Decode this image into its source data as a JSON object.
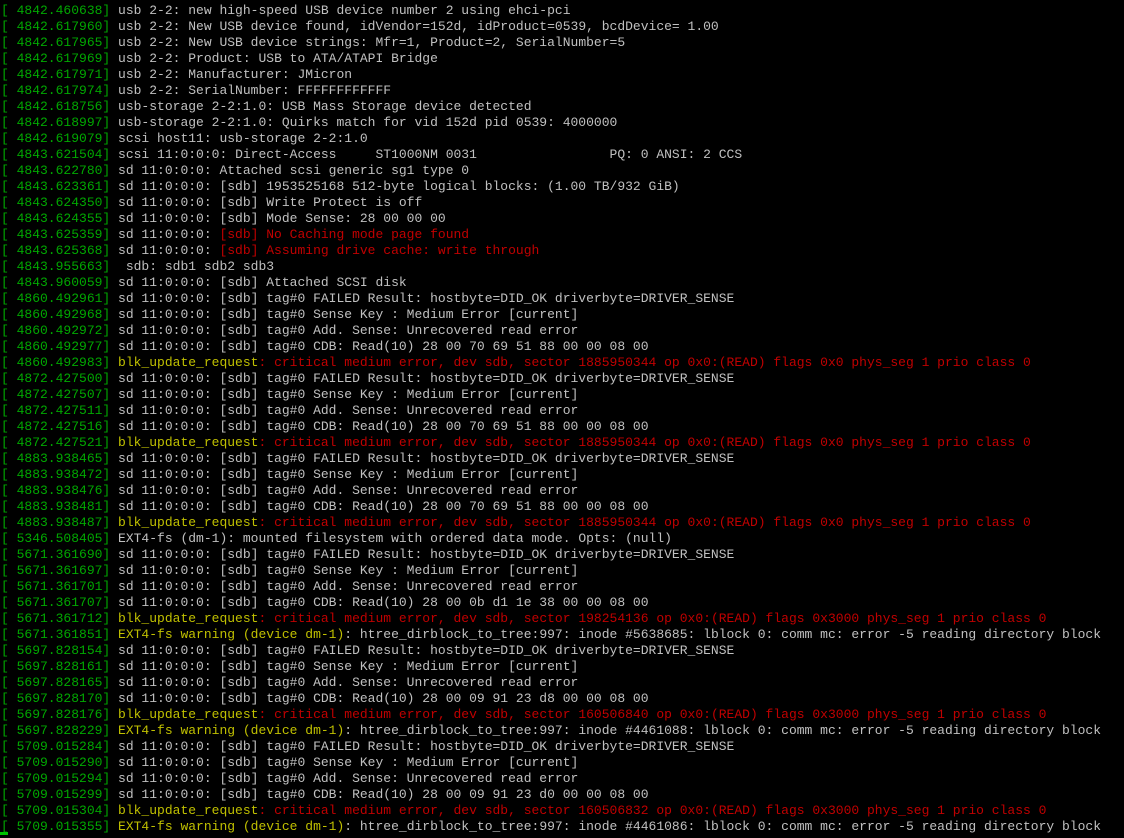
{
  "terminal": {
    "lines": [
      {
        "ts": "[ 4842.460638] ",
        "src": "usb 2-2: ",
        "msg": "new high-speed USB device number 2 using ehci-pci",
        "kind": "normal"
      },
      {
        "ts": "[ 4842.617960] ",
        "src": "usb 2-2: ",
        "msg": "New USB device found, idVendor=152d, idProduct=0539, bcdDevice= 1.00",
        "kind": "normal"
      },
      {
        "ts": "[ 4842.617965] ",
        "src": "usb 2-2: ",
        "msg": "New USB device strings: Mfr=1, Product=2, SerialNumber=5",
        "kind": "normal"
      },
      {
        "ts": "[ 4842.617969] ",
        "src": "usb 2-2: ",
        "msg": "Product: USB to ATA/ATAPI Bridge",
        "kind": "normal"
      },
      {
        "ts": "[ 4842.617971] ",
        "src": "usb 2-2: ",
        "msg": "Manufacturer: JMicron",
        "kind": "normal"
      },
      {
        "ts": "[ 4842.617974] ",
        "src": "usb 2-2: ",
        "msg": "SerialNumber: FFFFFFFFFFFF",
        "kind": "normal"
      },
      {
        "ts": "[ 4842.618756] ",
        "src": "usb-storage 2-2:1.0: ",
        "msg": "USB Mass Storage device detected",
        "kind": "normal"
      },
      {
        "ts": "[ 4842.618997] ",
        "src": "usb-storage 2-2:1.0: ",
        "msg": "Quirks match for vid 152d pid 0539: 4000000",
        "kind": "normal"
      },
      {
        "ts": "[ 4842.619079] ",
        "src": "scsi host11: ",
        "msg": "usb-storage 2-2:1.0",
        "kind": "normal"
      },
      {
        "ts": "[ 4843.621504] ",
        "src": "scsi 11:0:0:0: ",
        "msg": "Direct-Access     ST1000NM 0031                 PQ: 0 ANSI: 2 CCS",
        "kind": "normal"
      },
      {
        "ts": "[ 4843.622780] ",
        "src": "sd 11:0:0:0: ",
        "msg": "Attached scsi generic sg1 type 0",
        "kind": "normal"
      },
      {
        "ts": "[ 4843.623361] ",
        "src": "sd 11:0:0:0: ",
        "msg": "[sdb] 1953525168 512-byte logical blocks: (1.00 TB/932 GiB)",
        "kind": "normal"
      },
      {
        "ts": "[ 4843.624350] ",
        "src": "sd 11:0:0:0: ",
        "msg": "[sdb] Write Protect is off",
        "kind": "normal"
      },
      {
        "ts": "[ 4843.624355] ",
        "src": "sd 11:0:0:0: ",
        "msg": "[sdb] Mode Sense: 28 00 00 00",
        "kind": "normal"
      },
      {
        "ts": "[ 4843.625359] ",
        "src": "sd 11:0:0:0: ",
        "msg": "[sdb] No Caching mode page found",
        "kind": "red"
      },
      {
        "ts": "[ 4843.625368] ",
        "src": "sd 11:0:0:0: ",
        "msg": "[sdb] Assuming drive cache: write through",
        "kind": "red"
      },
      {
        "ts": "[ 4843.955663] ",
        "src": " sdb: ",
        "msg": "sdb1 sdb2 sdb3",
        "kind": "normal"
      },
      {
        "ts": "[ 4843.960059] ",
        "src": "sd 11:0:0:0: ",
        "msg": "[sdb] Attached SCSI disk",
        "kind": "normal"
      },
      {
        "ts": "[ 4860.492961] ",
        "src": "sd 11:0:0:0: ",
        "msg": "[sdb] tag#0 FAILED Result: hostbyte=DID_OK driverbyte=DRIVER_SENSE",
        "kind": "normal"
      },
      {
        "ts": "[ 4860.492968] ",
        "src": "sd 11:0:0:0: ",
        "msg": "[sdb] tag#0 Sense Key : Medium Error [current]",
        "kind": "normal"
      },
      {
        "ts": "[ 4860.492972] ",
        "src": "sd 11:0:0:0: ",
        "msg": "[sdb] tag#0 Add. Sense: Unrecovered read error",
        "kind": "normal"
      },
      {
        "ts": "[ 4860.492977] ",
        "src": "sd 11:0:0:0: ",
        "msg": "[sdb] tag#0 CDB: Read(10) 28 00 70 69 51 88 00 00 08 00",
        "kind": "normal"
      },
      {
        "ts": "[ 4860.492983] ",
        "src": "blk_update_request",
        "msg": ": critical medium error, dev sdb, sector 1885950344 op 0x0:(READ) flags 0x0 phys_seg 1 prio class 0",
        "kind": "crit"
      },
      {
        "ts": "[ 4872.427500] ",
        "src": "sd 11:0:0:0: ",
        "msg": "[sdb] tag#0 FAILED Result: hostbyte=DID_OK driverbyte=DRIVER_SENSE",
        "kind": "normal"
      },
      {
        "ts": "[ 4872.427507] ",
        "src": "sd 11:0:0:0: ",
        "msg": "[sdb] tag#0 Sense Key : Medium Error [current]",
        "kind": "normal"
      },
      {
        "ts": "[ 4872.427511] ",
        "src": "sd 11:0:0:0: ",
        "msg": "[sdb] tag#0 Add. Sense: Unrecovered read error",
        "kind": "normal"
      },
      {
        "ts": "[ 4872.427516] ",
        "src": "sd 11:0:0:0: ",
        "msg": "[sdb] tag#0 CDB: Read(10) 28 00 70 69 51 88 00 00 08 00",
        "kind": "normal"
      },
      {
        "ts": "[ 4872.427521] ",
        "src": "blk_update_request",
        "msg": ": critical medium error, dev sdb, sector 1885950344 op 0x0:(READ) flags 0x0 phys_seg 1 prio class 0",
        "kind": "crit"
      },
      {
        "ts": "[ 4883.938465] ",
        "src": "sd 11:0:0:0: ",
        "msg": "[sdb] tag#0 FAILED Result: hostbyte=DID_OK driverbyte=DRIVER_SENSE",
        "kind": "normal"
      },
      {
        "ts": "[ 4883.938472] ",
        "src": "sd 11:0:0:0: ",
        "msg": "[sdb] tag#0 Sense Key : Medium Error [current]",
        "kind": "normal"
      },
      {
        "ts": "[ 4883.938476] ",
        "src": "sd 11:0:0:0: ",
        "msg": "[sdb] tag#0 Add. Sense: Unrecovered read error",
        "kind": "normal"
      },
      {
        "ts": "[ 4883.938481] ",
        "src": "sd 11:0:0:0: ",
        "msg": "[sdb] tag#0 CDB: Read(10) 28 00 70 69 51 88 00 00 08 00",
        "kind": "normal"
      },
      {
        "ts": "[ 4883.938487] ",
        "src": "blk_update_request",
        "msg": ": critical medium error, dev sdb, sector 1885950344 op 0x0:(READ) flags 0x0 phys_seg 1 prio class 0",
        "kind": "crit"
      },
      {
        "ts": "[ 5346.508405] ",
        "src": "EXT4-fs (dm-1): ",
        "msg": "mounted filesystem with ordered data mode. Opts: (null)",
        "kind": "normal"
      },
      {
        "ts": "[ 5671.361690] ",
        "src": "sd 11:0:0:0: ",
        "msg": "[sdb] tag#0 FAILED Result: hostbyte=DID_OK driverbyte=DRIVER_SENSE",
        "kind": "normal"
      },
      {
        "ts": "[ 5671.361697] ",
        "src": "sd 11:0:0:0: ",
        "msg": "[sdb] tag#0 Sense Key : Medium Error [current]",
        "kind": "normal"
      },
      {
        "ts": "[ 5671.361701] ",
        "src": "sd 11:0:0:0: ",
        "msg": "[sdb] tag#0 Add. Sense: Unrecovered read error",
        "kind": "normal"
      },
      {
        "ts": "[ 5671.361707] ",
        "src": "sd 11:0:0:0: ",
        "msg": "[sdb] tag#0 CDB: Read(10) 28 00 0b d1 1e 38 00 00 08 00",
        "kind": "normal"
      },
      {
        "ts": "[ 5671.361712] ",
        "src": "blk_update_request",
        "msg": ": critical medium error, dev sdb, sector 198254136 op 0x0:(READ) flags 0x3000 phys_seg 1 prio class 0",
        "kind": "crit"
      },
      {
        "ts": "[ 5671.361851] ",
        "src": "EXT4-fs warning (device dm-1)",
        "msg": ": htree_dirblock_to_tree:997: inode #5638685: lblock 0: comm mc: error -5 reading directory block",
        "kind": "warn"
      },
      {
        "ts": "[ 5697.828154] ",
        "src": "sd 11:0:0:0: ",
        "msg": "[sdb] tag#0 FAILED Result: hostbyte=DID_OK driverbyte=DRIVER_SENSE",
        "kind": "normal"
      },
      {
        "ts": "[ 5697.828161] ",
        "src": "sd 11:0:0:0: ",
        "msg": "[sdb] tag#0 Sense Key : Medium Error [current]",
        "kind": "normal"
      },
      {
        "ts": "[ 5697.828165] ",
        "src": "sd 11:0:0:0: ",
        "msg": "[sdb] tag#0 Add. Sense: Unrecovered read error",
        "kind": "normal"
      },
      {
        "ts": "[ 5697.828170] ",
        "src": "sd 11:0:0:0: ",
        "msg": "[sdb] tag#0 CDB: Read(10) 28 00 09 91 23 d8 00 00 08 00",
        "kind": "normal"
      },
      {
        "ts": "[ 5697.828176] ",
        "src": "blk_update_request",
        "msg": ": critical medium error, dev sdb, sector 160506840 op 0x0:(READ) flags 0x3000 phys_seg 1 prio class 0",
        "kind": "crit"
      },
      {
        "ts": "[ 5697.828229] ",
        "src": "EXT4-fs warning (device dm-1)",
        "msg": ": htree_dirblock_to_tree:997: inode #4461088: lblock 0: comm mc: error -5 reading directory block",
        "kind": "warn"
      },
      {
        "ts": "[ 5709.015284] ",
        "src": "sd 11:0:0:0: ",
        "msg": "[sdb] tag#0 FAILED Result: hostbyte=DID_OK driverbyte=DRIVER_SENSE",
        "kind": "normal"
      },
      {
        "ts": "[ 5709.015290] ",
        "src": "sd 11:0:0:0: ",
        "msg": "[sdb] tag#0 Sense Key : Medium Error [current]",
        "kind": "normal"
      },
      {
        "ts": "[ 5709.015294] ",
        "src": "sd 11:0:0:0: ",
        "msg": "[sdb] tag#0 Add. Sense: Unrecovered read error",
        "kind": "normal"
      },
      {
        "ts": "[ 5709.015299] ",
        "src": "sd 11:0:0:0: ",
        "msg": "[sdb] tag#0 CDB: Read(10) 28 00 09 91 23 d0 00 00 08 00",
        "kind": "normal"
      },
      {
        "ts": "[ 5709.015304] ",
        "src": "blk_update_request",
        "msg": ": critical medium error, dev sdb, sector 160506832 op 0x0:(READ) flags 0x3000 phys_seg 1 prio class 0",
        "kind": "crit"
      },
      {
        "ts": "[ 5709.015355] ",
        "src": "EXT4-fs warning (device dm-1)",
        "msg": ": htree_dirblock_to_tree:997: inode #4461086: lblock 0: comm mc: error -5 reading directory block",
        "kind": "warn"
      }
    ]
  },
  "colors": {
    "background": "#000000",
    "timestamp": "#00a800",
    "text": "#c0c0c0",
    "critical_prefix": "#c0c000",
    "critical_text": "#c00000",
    "cursor": "#00c000"
  }
}
